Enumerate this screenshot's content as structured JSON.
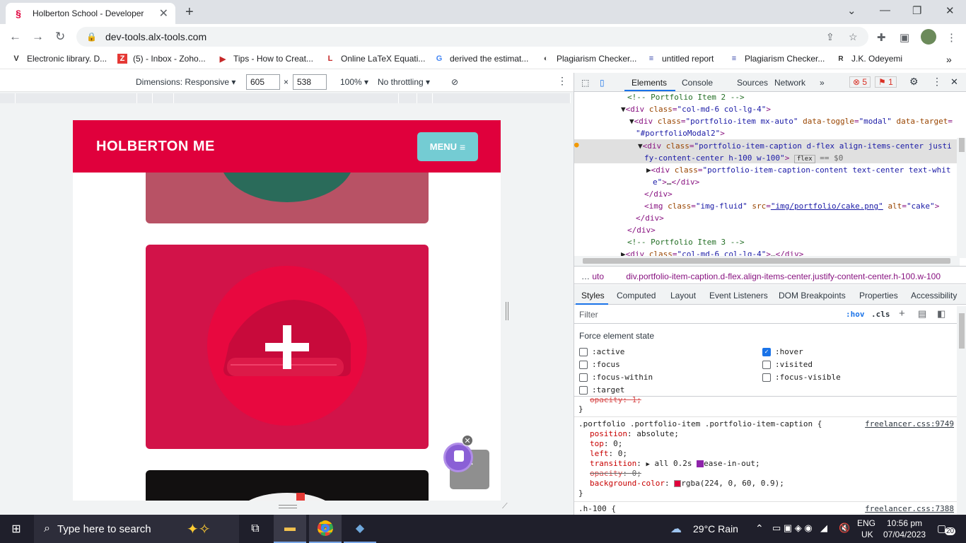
{
  "browser": {
    "tab_title": "Holberton School - Developer to",
    "url": "dev-tools.alx-tools.com",
    "bookmarks": [
      {
        "label": "Electronic library. D...",
        "icon": "book-icon"
      },
      {
        "label": "(5) - Inbox - Zoho...",
        "icon": "zoho-icon"
      },
      {
        "label": "Tips - How to Creat...",
        "icon": "play-icon"
      },
      {
        "label": "Online LaTeX Equati...",
        "icon": "latex-icon"
      },
      {
        "label": "derived the estimat...",
        "icon": "google-icon"
      },
      {
        "label": "Plagiarism Checker...",
        "icon": "plagiarism-icon"
      },
      {
        "label": "untitled report",
        "icon": "report-icon"
      },
      {
        "label": "Plagiarism Checker...",
        "icon": "report-icon"
      },
      {
        "label": "J.K. Odeyemi",
        "icon": "researchgate-icon"
      }
    ]
  },
  "device_toolbar": {
    "dimensions_label": "Dimensions: Responsive",
    "width": "605",
    "height": "538",
    "zoom": "100%",
    "throttling": "No throttling"
  },
  "site": {
    "brand": "HOLBERTON ME",
    "menu_label": "MENU",
    "colors": {
      "header": "#e0003c",
      "menu_button": "#74ccd3",
      "card_red": "#d21349"
    }
  },
  "devtools": {
    "tabs": [
      "Elements",
      "Console",
      "Sources",
      "Network"
    ],
    "error_count": "5",
    "issue_count": "1",
    "breadcrumb_left": "uto",
    "breadcrumb": "div.portfolio-item-caption.d-flex.align-items-center.justify-content-center.h-100.w-100",
    "subtabs": [
      "Styles",
      "Computed",
      "Layout",
      "Event Listeners",
      "DOM Breakpoints",
      "Properties",
      "Accessibility"
    ],
    "filter_placeholder": "Filter",
    "hov": ":hov",
    "cls": ".cls",
    "force_state_title": "Force element state",
    "states_left": [
      ":active",
      ":focus",
      ":focus-within",
      ":target"
    ],
    "states_right": [
      ":hover",
      ":visited",
      ":focus-visible"
    ],
    "rule_selector": ".portfolio .portfolio-item .portfolio-item-caption {",
    "rule_source": "freelancer.css:9749",
    "rule2_selector": ".h-100 {",
    "rule2_source": "freelancer.css:7388",
    "decls": {
      "position": "absolute;",
      "top": "0;",
      "left": "0;",
      "transition": "all 0.2s",
      "transition_easing": "ease-in-out;",
      "opacity": "0;",
      "background_color": "rgba(224, 0, 60, 0.9);",
      "prev_opacity": "opacity: 1;"
    }
  },
  "taskbar": {
    "search_placeholder": "Type here to search",
    "weather": "29°C  Rain",
    "lang1": "ENG",
    "lang2": "UK",
    "time": "10:56 pm",
    "date": "07/04/2023",
    "notifications": "20"
  }
}
